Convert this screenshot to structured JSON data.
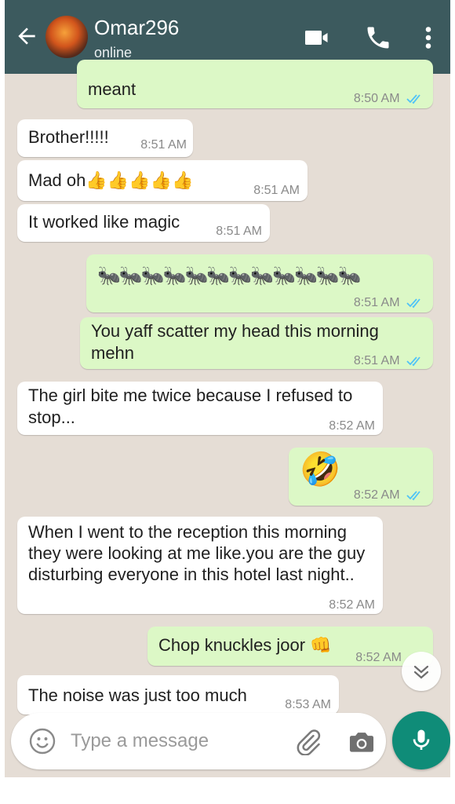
{
  "header": {
    "contact_name": "Omar296",
    "status": "online",
    "icons": [
      "back-arrow-icon",
      "video-call-icon",
      "phone-icon",
      "more-vert-icon"
    ]
  },
  "messages": [
    {
      "direction": "out",
      "text": "meant",
      "time": "8:50 AM",
      "read": true
    },
    {
      "direction": "in",
      "text": "Brother!!!!!",
      "time": "8:51 AM"
    },
    {
      "direction": "in",
      "text": "Mad oh👍👍👍👍👍",
      "time": "8:51 AM"
    },
    {
      "direction": "in",
      "text": "It worked like magic",
      "time": "8:51 AM"
    },
    {
      "direction": "out",
      "text": "🐜🐜🐜🐜🐜🐜🐜🐜🐜🐜🐜🐜",
      "time": "8:51 AM",
      "read": true
    },
    {
      "direction": "out",
      "text": "You yaff scatter my head this morning mehn",
      "time": "8:51 AM",
      "read": true
    },
    {
      "direction": "in",
      "text": "The girl bite me twice because I refused to stop...",
      "time": "8:52 AM"
    },
    {
      "direction": "out",
      "text": "🤣",
      "time": "8:52 AM",
      "read": true
    },
    {
      "direction": "in",
      "text": "When I went to the reception this morning they were looking at me like.you are the guy disturbing everyone in this hotel last night..",
      "time": "8:52 AM"
    },
    {
      "direction": "out",
      "text": "Chop knuckles joor 👊",
      "time": "8:52 AM",
      "read": true
    },
    {
      "direction": "in",
      "text": "The noise was just too much",
      "time": "8:53 AM"
    }
  ],
  "composer": {
    "placeholder": "Type a message",
    "icons": [
      "emoji-icon",
      "attach-icon",
      "camera-icon",
      "mic-icon"
    ]
  },
  "colors": {
    "header": "#3c5a5e",
    "chat_bg": "#e5ddd5",
    "outgoing_bubble": "#dcf8c6",
    "incoming_bubble": "#ffffff",
    "read_ticks": "#4fc3f7",
    "mic_button": "#0f8c78"
  }
}
